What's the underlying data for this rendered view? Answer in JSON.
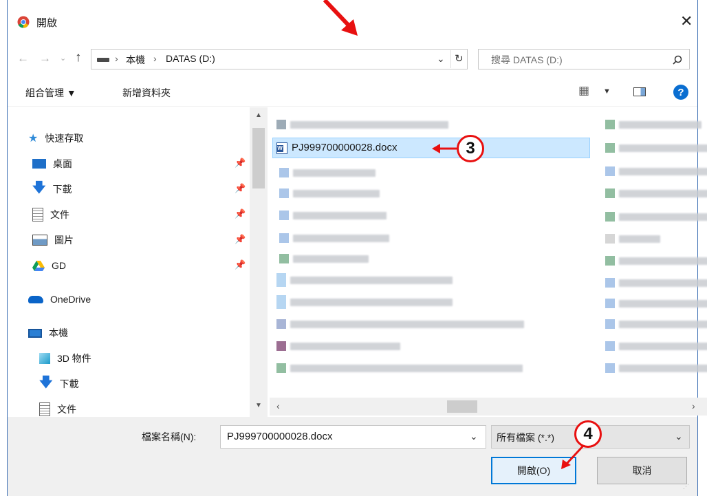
{
  "title": "開啟",
  "address": {
    "path_pc": "本機",
    "path_drive": "DATAS (D:)",
    "search_placeholder": "搜尋 DATAS (D:)"
  },
  "toolbar": {
    "organize": "組合管理 ▼",
    "new_folder": "新增資料夾"
  },
  "nav": {
    "quick_access": "快速存取",
    "desktop": "桌面",
    "downloads": "下載",
    "documents": "文件",
    "pictures": "圖片",
    "gd": "GD",
    "onedrive": "OneDrive",
    "this_pc": "本機",
    "objects3d": "3D 物件",
    "downloads2": "下載",
    "documents2": "文件"
  },
  "files": {
    "selected_name": "PJ999700000028.docx"
  },
  "bottom": {
    "filename_label": "檔案名稱(N):",
    "filename_value": "PJ999700000028.docx",
    "filetype": "所有檔案 (*.*)",
    "open_button": "開啟(O)",
    "cancel_button": "取消"
  },
  "callouts": {
    "step3": "3",
    "step4": "4"
  },
  "colors": {
    "accent": "#0078d7",
    "selection": "#cce8ff",
    "callout_red": "#e81010",
    "frame_blue": "#3c6fb4"
  }
}
